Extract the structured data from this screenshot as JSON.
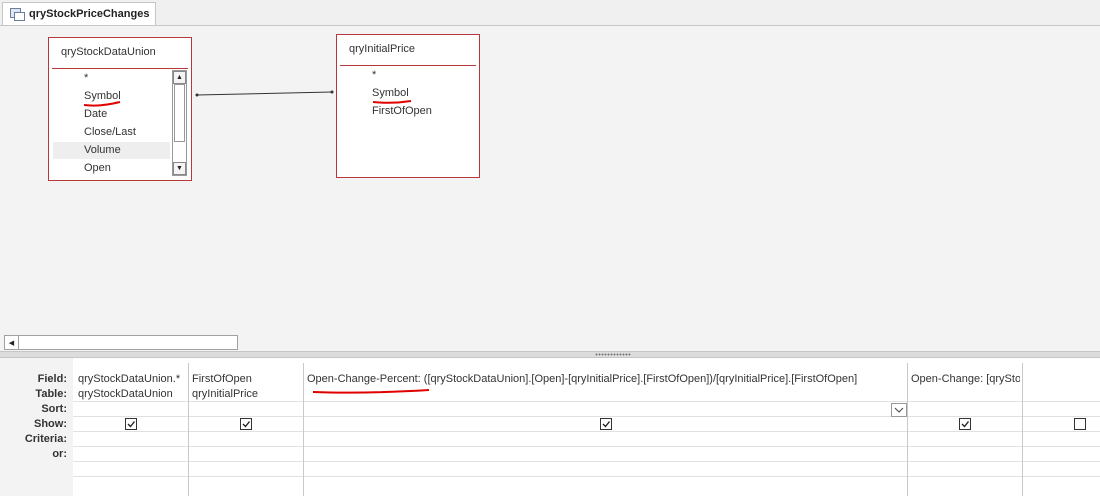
{
  "tab": {
    "title": "qryStockPriceChanges"
  },
  "tables": [
    {
      "name": "qryStockDataUnion",
      "fields": [
        "*",
        "Symbol",
        "Date",
        "Close/Last",
        "Volume",
        "Open"
      ]
    },
    {
      "name": "qryInitialPrice",
      "fields": [
        "*",
        "Symbol",
        "FirstOfOpen"
      ]
    }
  ],
  "grid": {
    "row_labels": [
      "Field:",
      "Table:",
      "Sort:",
      "Show:",
      "Criteria:",
      "or:"
    ],
    "columns": [
      {
        "field": "qryStockDataUnion.*",
        "table": "qryStockDataUnion",
        "show": true
      },
      {
        "field": "FirstOfOpen",
        "table": "qryInitialPrice",
        "show": true
      },
      {
        "field": "Open-Change-Percent: ([qryStockDataUnion].[Open]-[qryInitialPrice].[FirstOfOpen])/[qryInitialPrice].[FirstOfOpen]",
        "table": "",
        "show": true
      },
      {
        "field": "Open-Change: [qrySto",
        "table": "",
        "show": true
      },
      {
        "field": "",
        "table": "",
        "show": false
      }
    ]
  },
  "colors": {
    "table_border": "#b5393a",
    "annotation": "#e00000"
  }
}
